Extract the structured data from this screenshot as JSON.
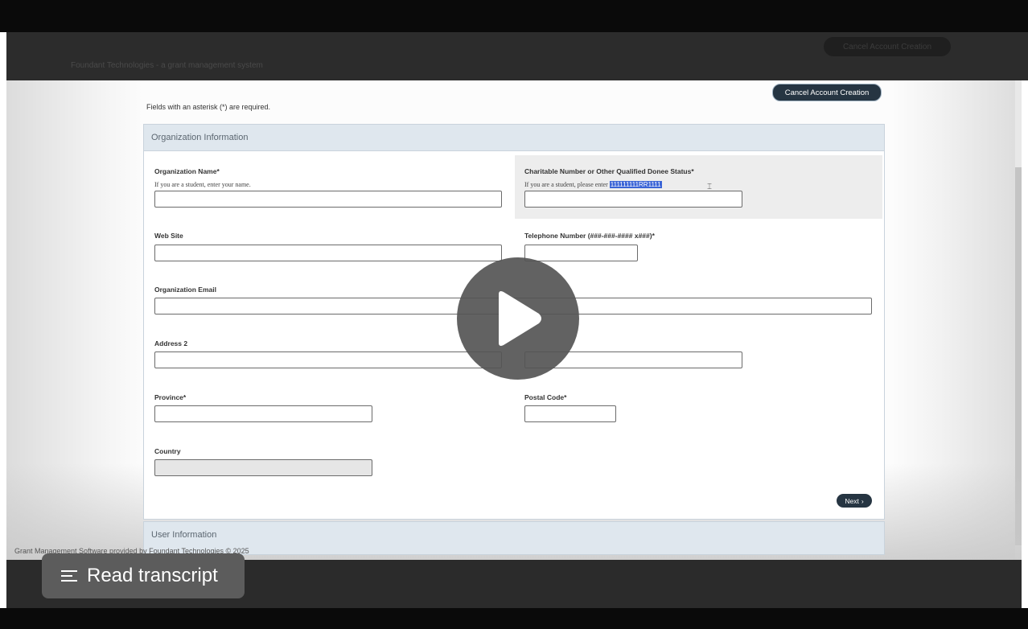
{
  "page": {
    "required_note": "Fields with an asterisk (*) are required.",
    "cancel_label": "Cancel Account Creation",
    "ghost_cancel_label": "Cancel Account Creation",
    "ghost_top_text": "Foundant Technologies - a grant management system",
    "footer": "Grant Management Software provided by Foundant Technologies © 2025"
  },
  "sections": {
    "organization": {
      "title": "Organization Information"
    },
    "user": {
      "title": "User Information"
    }
  },
  "fields": {
    "org_name": {
      "label": "Organization Name*",
      "help": "If you are a student, enter your name.",
      "value": ""
    },
    "charitable": {
      "label": "Charitable Number or Other Qualified Donee Status*",
      "help": "If you are a student, please enter",
      "help_selected": "111111111RR1111",
      "value": ""
    },
    "website": {
      "label": "Web Site",
      "value": ""
    },
    "telephone": {
      "label": "Telephone Number (###-###-#### x###)*",
      "value": ""
    },
    "org_email": {
      "label": "Organization Email",
      "value": ""
    },
    "address2": {
      "label": "Address 2",
      "value": ""
    },
    "province": {
      "label": "Province*",
      "value": ""
    },
    "postal": {
      "label": "Postal Code*",
      "value": ""
    },
    "country": {
      "label": "Country",
      "value": ""
    }
  },
  "buttons": {
    "next_label": "Next",
    "next_icon": "chevron-right-icon"
  },
  "video": {
    "play_icon": "play-icon",
    "transcript_label": "Read transcript",
    "transcript_icon": "lines-icon"
  },
  "colors": {
    "button_dark": "#263542",
    "section_header": "#dfe7ee",
    "selection": "#3a64d6"
  }
}
